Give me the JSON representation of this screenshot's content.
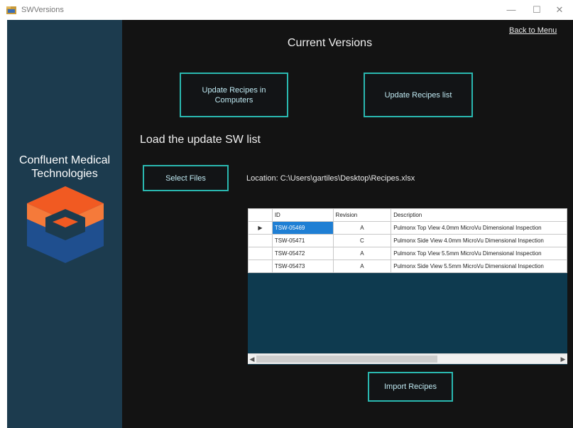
{
  "window": {
    "title": "SWVersions"
  },
  "sidebar": {
    "company_line1": "Confluent Medical",
    "company_line2": "Technologies"
  },
  "header": {
    "back_link": "Back to Menu",
    "title": "Current Versions"
  },
  "actions": {
    "update_computers": "Update Recipes in Computers",
    "update_list": "Update Recipes list",
    "select_files": "Select Files",
    "import": "Import Recipes"
  },
  "load_section": {
    "title": "Load the update SW list",
    "location_label": "Location:",
    "location_path": "C:\\Users\\gartiles\\Desktop\\Recipes.xlsx"
  },
  "grid": {
    "columns": [
      "ID",
      "Revision",
      "Description"
    ],
    "rows": [
      {
        "id": "TSW-05469",
        "revision": "A",
        "description": "Pulmonx Top View 4.0mm MicroVu Dimensional Inspection"
      },
      {
        "id": "TSW-05471",
        "revision": "C",
        "description": "Pulmonx Side View 4.0mm MicroVu Dimensional Inspection"
      },
      {
        "id": "TSW-05472",
        "revision": "A",
        "description": "Pulmonx Top View 5.5mm MicroVu Dimensional Inspection"
      },
      {
        "id": "TSW-05473",
        "revision": "A",
        "description": "Pulmonx Side View 5.5mm MicroVu Dimensional Inspection"
      }
    ]
  },
  "colors": {
    "sidebar": "#1c3b4e",
    "background": "#131313",
    "accent": "#2ab8b0",
    "logo_orange": "#f15a22",
    "logo_blue": "#1f4f8f"
  }
}
